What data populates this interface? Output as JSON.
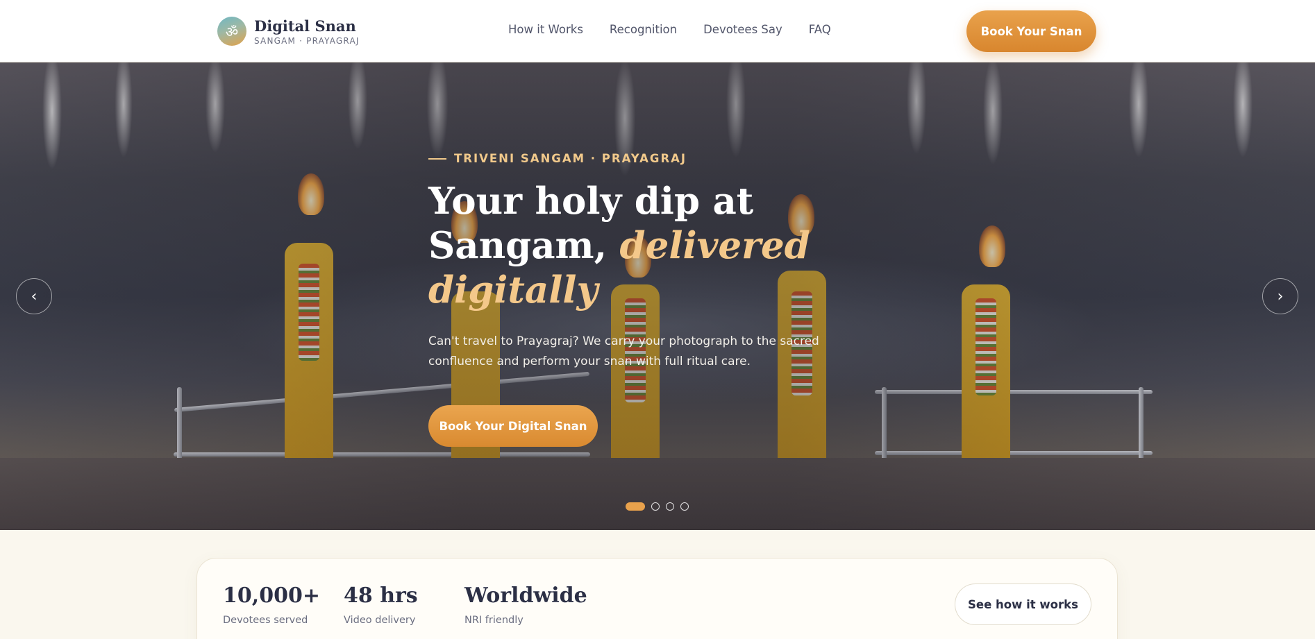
{
  "brand": {
    "logo_glyph": "ॐ",
    "name": "Digital Snan",
    "tagline": "SANGAM · PRAYAGRAJ"
  },
  "nav": {
    "links": [
      "How it Works",
      "Recognition",
      "Devotees Say",
      "FAQ"
    ],
    "cta_label": "Book Your Snan"
  },
  "hero": {
    "eyebrow": "TRIVENI SANGAM · PRAYAGRAJ",
    "headline_plain": "Your holy dip at Sangam, ",
    "headline_accent": "delivered digitally",
    "subtext": "Can't travel to Prayagraj? We carry your photograph to the sacred confluence and perform your snan with full ritual care.",
    "cta_label": "Book Your Digital Snan",
    "prev_icon": "chevron-left-icon",
    "next_icon": "chevron-right-icon",
    "prev_glyph": "‹",
    "next_glyph": "›",
    "slides": {
      "count": 4,
      "active_index": 0
    }
  },
  "stats": {
    "items": [
      {
        "value": "10,000+",
        "label": "Devotees served"
      },
      {
        "value": "48 hrs",
        "label": "Video delivery"
      },
      {
        "value": "Worldwide",
        "label": "NRI friendly"
      }
    ],
    "cta_label": "See how it works"
  },
  "colors": {
    "accent": "#e09530",
    "accent_light": "#f4c88a",
    "text_dark": "#2b2f45",
    "background": "#faf7ee"
  }
}
